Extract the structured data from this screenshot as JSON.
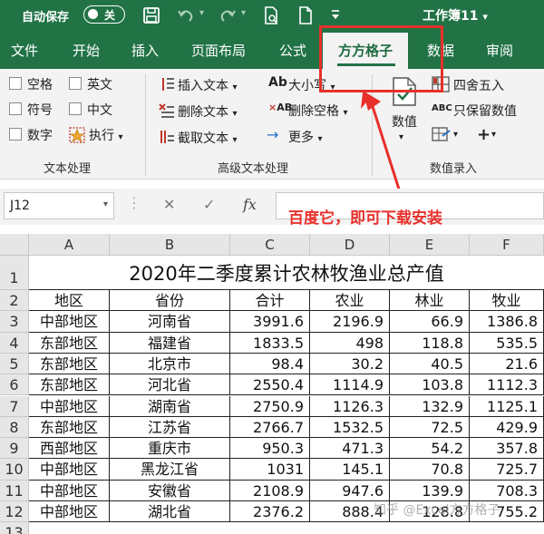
{
  "titlebar": {
    "autosave_label": "自动保存",
    "autosave_state": "关",
    "doc_title": "工作簿11",
    "doc_title_caret": "▾"
  },
  "tabs": [
    "文件",
    "开始",
    "插入",
    "页面布局",
    "公式",
    "方方格子",
    "数据",
    "审阅"
  ],
  "active_tab": "方方格子",
  "ribbon": {
    "text_group": {
      "items": [
        "空格",
        "英文",
        "符号",
        "中文",
        "数字",
        "执行"
      ],
      "label": "文本处理"
    },
    "advanced_group": {
      "insert_text": "插入文本",
      "delete_text": "删除文本",
      "extract_text": "截取文本",
      "font_size": "大小写",
      "delete_space": "删除空格",
      "more": "更多",
      "label": "高级文本处理"
    },
    "number_group": {
      "value_btn": "数值",
      "round": "四舍五入",
      "keep_value": "只保留数值",
      "label": "数值录入",
      "caret": "▾"
    }
  },
  "annotation": "百度它，即可下载安装",
  "formula_bar": {
    "cell_ref": "J12",
    "cancel": "✕",
    "confirm": "✓",
    "fx": "fx"
  },
  "columns": [
    "A",
    "B",
    "C",
    "D",
    "E",
    "F"
  ],
  "rows": [
    "1",
    "2",
    "3",
    "4",
    "5",
    "6",
    "7",
    "8",
    "9",
    "10",
    "11",
    "12",
    "13"
  ],
  "sheet_title": "2020年二季度累计农林牧渔业总产值",
  "table_headers": [
    "地区",
    "省份",
    "合计",
    "农业",
    "林业",
    "牧业"
  ],
  "table_rows": [
    [
      "中部地区",
      "河南省",
      "3991.6",
      "2196.9",
      "66.9",
      "1386.8"
    ],
    [
      "东部地区",
      "福建省",
      "1833.5",
      "498",
      "118.8",
      "535.5"
    ],
    [
      "东部地区",
      "北京市",
      "98.4",
      "30.2",
      "40.5",
      "21.6"
    ],
    [
      "东部地区",
      "河北省",
      "2550.4",
      "1114.9",
      "103.8",
      "1112.3"
    ],
    [
      "中部地区",
      "湖南省",
      "2750.9",
      "1126.3",
      "132.9",
      "1125.1"
    ],
    [
      "东部地区",
      "江苏省",
      "2766.7",
      "1532.5",
      "72.5",
      "429.9"
    ],
    [
      "西部地区",
      "重庆市",
      "950.3",
      "471.3",
      "54.2",
      "357.8"
    ],
    [
      "中部地区",
      "黑龙江省",
      "1031",
      "145.1",
      "70.8",
      "725.7"
    ],
    [
      "中部地区",
      "安徽省",
      "2108.9",
      "947.6",
      "139.9",
      "708.3"
    ],
    [
      "中部地区",
      "湖北省",
      "2376.2",
      "888.4",
      "128.8",
      "755.2"
    ]
  ],
  "watermark": "知乎 @Excel方方格子"
}
